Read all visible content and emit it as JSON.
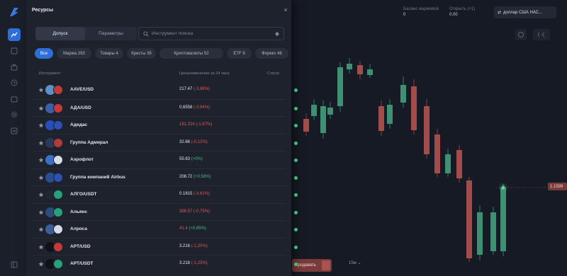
{
  "chart_top": {
    "balance_label": "Баланс маржевой",
    "balance_value": "0",
    "open_label": "Открыть (+1)",
    "open_value": "0.00",
    "asset_label": "доллар США НАС...",
    "price_tag": "1.1599",
    "sell_label": "Продавать",
    "time_label": "15м"
  },
  "panel": {
    "title": "Ресурсы",
    "close_glyph": "×",
    "tabs": [
      {
        "label": "Допуск"
      },
      {
        "label": "Параметры"
      }
    ],
    "search_placeholder": "Инструмент поиска",
    "chips": [
      {
        "label": "Все"
      },
      {
        "label": "Маржа 293"
      },
      {
        "label": "Товары 4"
      },
      {
        "label": "Кресты 39"
      },
      {
        "label": "Криптовалюты 52"
      },
      {
        "label": "ETF 9"
      },
      {
        "label": "Форекс 46"
      }
    ],
    "columns": {
      "instrument": "Инструмент",
      "price": "Цена/изменение за 24 часа",
      "status": "Статус"
    },
    "rows": [
      {
        "name": "AAVE/USD",
        "price": "217.47",
        "change": "(-3,88%)"
      },
      {
        "name": "АДА/USD",
        "price": "0,6558",
        "change": "(-3,94%)"
      },
      {
        "name": "Адидас",
        "price": "191.324",
        "change": "(-1,67%)"
      },
      {
        "name": "Группа Адмирал",
        "price": "32.66",
        "change": "(-0,12%)"
      },
      {
        "name": "Аэрофлот",
        "price": "55.63",
        "change": "(+0%)"
      },
      {
        "name": "Группа компаний Airbus",
        "price": "208.72",
        "change": "(+0,58%)"
      },
      {
        "name": "АЛГО/USDT",
        "price": "0.1815",
        "change": "(-3,61%)"
      },
      {
        "name": "Альянс",
        "price": "398.57",
        "change": "(-0,75%)"
      },
      {
        "name": "Алроса",
        "price": "41.4",
        "change": "(+0,85%)"
      },
      {
        "name": "APT/USD",
        "price": "3.216",
        "change": "(-1,20%)"
      },
      {
        "name": "APT/USDT",
        "price": "3.218",
        "change": "(-1,23%)"
      }
    ]
  },
  "colors": {
    "accent": "#2d6fd6",
    "up": "#3fbf7f",
    "down": "#e25757",
    "panel_bg": "#1e222d",
    "page_bg": "#161a24"
  },
  "icons": {
    "logo": "broker-logo",
    "rail": [
      "chart-icon",
      "trades-icon",
      "portfolio-icon",
      "history-icon",
      "wallet-icon",
      "settings-icon",
      "calendar-icon"
    ],
    "rail_bottom": "layout-icon",
    "search": "search-icon",
    "filter": "filter-icon",
    "favorite": "star-icon",
    "status": "status-dot-icon"
  }
}
